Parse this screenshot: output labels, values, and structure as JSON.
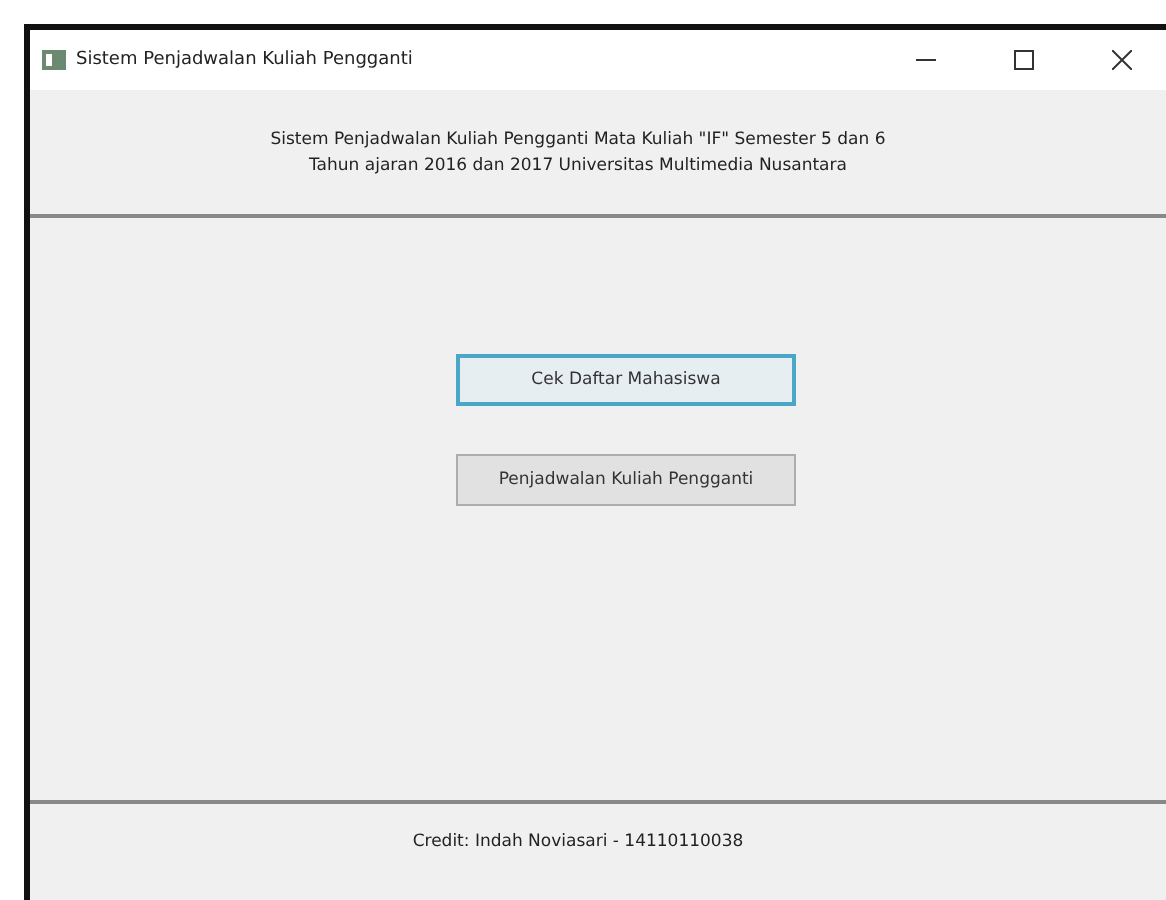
{
  "window": {
    "title": "Sistem Penjadwalan Kuliah Pengganti"
  },
  "header": {
    "lines": [
      "Sistem Penjadwalan Kuliah Pengganti Mata Kuliah \"IF\" Semester 5 dan 6",
      "Tahun ajaran 2016 dan 2017 Universitas Multimedia Nusantara"
    ]
  },
  "buttons": [
    {
      "label": "Cek Daftar Mahasiswa",
      "focused": true
    },
    {
      "label": "Penjadwalan Kuliah Pengganti",
      "focused": false
    }
  ],
  "footer": {
    "text": "Credit: Indah Noviasari - 14110110038"
  }
}
